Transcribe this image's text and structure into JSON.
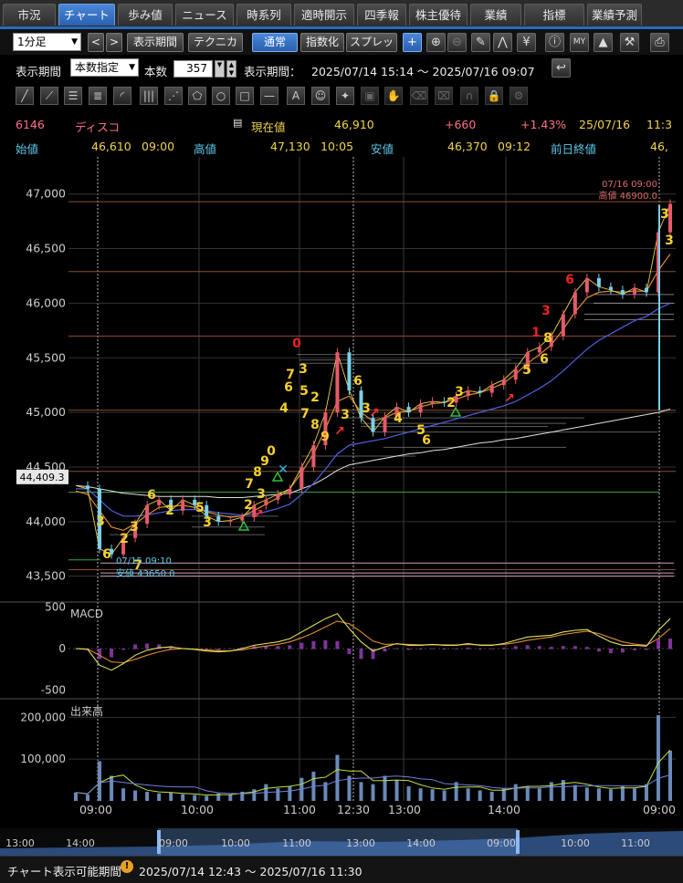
{
  "tabs": [
    {
      "label": "市況",
      "w": 58,
      "active": false
    },
    {
      "label": "チャート",
      "w": 62,
      "active": true
    },
    {
      "label": "歩み値",
      "w": 60,
      "active": false
    },
    {
      "label": "ニュース",
      "w": 64,
      "active": false
    },
    {
      "label": "時系列",
      "w": 60,
      "active": false
    },
    {
      "label": "適時開示",
      "w": 66,
      "active": false
    },
    {
      "label": "四季報",
      "w": 54,
      "active": false
    },
    {
      "label": "株主優待",
      "w": 64,
      "active": false
    },
    {
      "label": "業績",
      "w": 56,
      "active": false
    },
    {
      "label": "指標",
      "w": 66,
      "active": false
    },
    {
      "label": "業績予測",
      "w": 60,
      "active": false
    }
  ],
  "toolbar": {
    "interval": "1分足",
    "prev": "<",
    "next": ">",
    "period_btn": "表示期間",
    "technical_btn": "テクニカル",
    "normal_btn": "通常",
    "index_btn": "指数化",
    "spread_btn": "スプレッド"
  },
  "period": {
    "label": "表示期間",
    "mode": "本数指定",
    "count_label": "本数",
    "count": "357",
    "range_label": "表示期間：",
    "range": "2025/07/14 15:14 ～ 2025/07/16 09:07"
  },
  "quote": {
    "code": "6146",
    "name": "ディスコ",
    "current_label": "現在値",
    "current": "46,910",
    "change": "+660",
    "change_pct": "+1.43%",
    "date": "25/07/16",
    "time": "11:3",
    "open_label": "始値",
    "open": "46,610",
    "open_time": "09:00",
    "high_label": "高値",
    "high": "47,130",
    "high_time": "10:05",
    "low_label": "安値",
    "low": "46,370",
    "low_time": "09:12",
    "prev_close_label": "前日終値",
    "prev_close": "46,"
  },
  "chart_data": {
    "type": "candlestick",
    "y_ticks": [
      "47,000",
      "46,500",
      "46,000",
      "45,500",
      "45,000",
      "44,500",
      "44,000",
      "43,500"
    ],
    "y_values": [
      47000,
      46500,
      46000,
      45500,
      45000,
      44500,
      44000,
      43500
    ],
    "ylim": [
      43280,
      47340
    ],
    "x_ticks": [
      "09:00",
      "10:00",
      "11:00",
      "12:30",
      "13:00",
      "14:00",
      "09:00"
    ],
    "price_marker": "44,409.3",
    "price_marker_value": 44409.3,
    "high_annotation": {
      "time": "07/16 09:00",
      "label": "高値 46900.0",
      "value": 46900
    },
    "low_annotation": {
      "time": "07/15 09:10",
      "label": "安値 43650.0",
      "value": 43650
    },
    "close_path": [
      44330,
      44300,
      43750,
      43700,
      43850,
      43980,
      44150,
      44200,
      44100,
      44200,
      44150,
      44050,
      44000,
      44010,
      44040,
      44150,
      44200,
      44250,
      44300,
      44500,
      44700,
      45000,
      45550,
      45200,
      44950,
      44820,
      44960,
      45050,
      45000,
      45080,
      45100,
      45090,
      45150,
      45200,
      45180,
      45250,
      45300,
      45400,
      45550,
      45600,
      45700,
      45900,
      46100,
      46230,
      46150,
      46120,
      46080,
      46140,
      46100,
      46650,
      46910
    ],
    "ma_short": [
      44280,
      44250,
      44100,
      43950,
      43920,
      43980,
      44060,
      44130,
      44140,
      44150,
      44130,
      44090,
      44060,
      44040,
      44050,
      44100,
      44160,
      44220,
      44300,
      44450,
      44620,
      44850,
      45100,
      45150,
      45000,
      44920,
      44950,
      45000,
      45010,
      45050,
      45080,
      45090,
      45120,
      45160,
      45180,
      45220,
      45270,
      45350,
      45450,
      45530,
      45620,
      45760,
      45920,
      46050,
      46100,
      46110,
      46100,
      46110,
      46110,
      46300,
      46450
    ],
    "ma_long": [
      44300,
      44300,
      44200,
      44100,
      44050,
      44050,
      44060,
      44080,
      44100,
      44110,
      44110,
      44100,
      44080,
      44070,
      44060,
      44070,
      44090,
      44120,
      44160,
      44250,
      44350,
      44480,
      44620,
      44700,
      44720,
      44740,
      44760,
      44790,
      44820,
      44850,
      44880,
      44910,
      44940,
      44970,
      45000,
      45030,
      45060,
      45100,
      45160,
      45220,
      45290,
      45380,
      45480,
      45580,
      45660,
      45720,
      45780,
      45840,
      45880,
      45950,
      46000
    ],
    "ma_vlong": [
      44330,
      44320,
      44300,
      44280,
      44260,
      44250,
      44240,
      44230,
      44230,
      44230,
      44230,
      44230,
      44220,
      44220,
      44220,
      44230,
      44240,
      44250,
      44260,
      44300,
      44340,
      44400,
      44470,
      44520,
      44540,
      44560,
      44580,
      44600,
      44620,
      44630,
      44650,
      44660,
      44680,
      44700,
      44720,
      44730,
      44750,
      44760,
      44780,
      44800,
      44820,
      44840,
      44860,
      44880,
      44900,
      44920,
      44940,
      44960,
      44980,
      45000,
      45030
    ],
    "macd": {
      "label": "MACD",
      "ticks": [
        "500",
        "0",
        "-500"
      ],
      "tick_values": [
        500,
        0,
        -500
      ],
      "range": [
        -560,
        560
      ],
      "line": [
        0,
        -10,
        -200,
        -260,
        -180,
        -80,
        -20,
        10,
        20,
        0,
        -10,
        -30,
        -40,
        -30,
        0,
        40,
        60,
        80,
        120,
        200,
        280,
        360,
        420,
        240,
        80,
        -30,
        20,
        60,
        40,
        40,
        50,
        40,
        40,
        60,
        40,
        40,
        60,
        100,
        140,
        150,
        160,
        200,
        220,
        230,
        150,
        80,
        40,
        40,
        30,
        220,
        360
      ],
      "signal": [
        0,
        -5,
        -80,
        -160,
        -170,
        -130,
        -80,
        -40,
        -10,
        0,
        -5,
        -15,
        -25,
        -28,
        -15,
        10,
        30,
        50,
        80,
        130,
        190,
        260,
        330,
        300,
        200,
        90,
        50,
        55,
        50,
        45,
        47,
        45,
        43,
        50,
        45,
        43,
        50,
        70,
        100,
        120,
        140,
        170,
        190,
        210,
        180,
        130,
        80,
        55,
        40,
        120,
        240
      ]
    },
    "volume": {
      "label": "出来高",
      "ticks": [
        "200,000",
        "100,000"
      ],
      "tick_values": [
        200000,
        100000
      ],
      "range": [
        0,
        240000
      ],
      "bars": [
        20000,
        15000,
        95000,
        60000,
        30000,
        25000,
        22000,
        18000,
        20000,
        16000,
        14000,
        12000,
        18000,
        15000,
        22000,
        28000,
        40000,
        30000,
        35000,
        55000,
        70000,
        45000,
        110000,
        60000,
        45000,
        40000,
        60000,
        50000,
        35000,
        30000,
        28000,
        25000,
        45000,
        30000,
        25000,
        22000,
        30000,
        40000,
        35000,
        30000,
        45000,
        50000,
        38000,
        32000,
        30000,
        28000,
        35000,
        30000,
        40000,
        205000,
        120000
      ]
    }
  },
  "signals": {
    "yellow": [
      [
        "3",
        110,
        571
      ],
      [
        "6",
        117,
        607
      ],
      [
        "2",
        136,
        590
      ],
      [
        "3",
        147,
        577
      ],
      [
        "7",
        151,
        619
      ],
      [
        "6",
        166,
        542
      ],
      [
        "2",
        186,
        559
      ],
      [
        "5",
        219,
        556
      ],
      [
        "3",
        227,
        572
      ],
      [
        "2",
        272,
        553
      ],
      [
        "3",
        286,
        541
      ],
      [
        "7",
        273,
        530
      ],
      [
        "8",
        282,
        517
      ],
      [
        "9",
        290,
        505
      ],
      [
        "0",
        297,
        494
      ],
      [
        "4",
        311,
        447
      ],
      [
        "6",
        316,
        424
      ],
      [
        "7",
        318,
        410
      ],
      [
        "3",
        332,
        404
      ],
      [
        "5",
        333,
        428
      ],
      [
        "2",
        345,
        435
      ],
      [
        "7",
        334,
        453
      ],
      [
        "8",
        345,
        465
      ],
      [
        "9",
        356,
        478
      ],
      [
        "3",
        378,
        454
      ],
      [
        "6",
        392,
        417
      ],
      [
        "3",
        401,
        447
      ],
      [
        "4",
        436,
        458
      ],
      [
        "5",
        461,
        471
      ],
      [
        "6",
        467,
        482
      ],
      [
        "2",
        494,
        441
      ],
      [
        "3",
        503,
        429
      ],
      [
        "5",
        577,
        405
      ],
      [
        "6",
        596,
        393
      ],
      [
        "8",
        600,
        370
      ],
      [
        "3",
        728,
        234
      ],
      [
        "3",
        733,
        263
      ]
    ],
    "red": [
      [
        "0",
        325,
        376
      ],
      [
        "1",
        587,
        364
      ],
      [
        "3",
        598,
        340
      ],
      [
        "6",
        624,
        306
      ]
    ]
  },
  "x_range": {
    "start": "13:00",
    "t1": "14:00",
    "t2": "09:00",
    "t3": "10:00",
    "t4": "11:00",
    "t5": "13:00",
    "t6": "14:00",
    "t7": "09:00",
    "t8": "10:00",
    "t9": "11:00"
  },
  "footer": {
    "label": "チャート表示可能期間",
    "range": "2025/07/14 12:43 ～ 2025/07/16 11:30"
  }
}
